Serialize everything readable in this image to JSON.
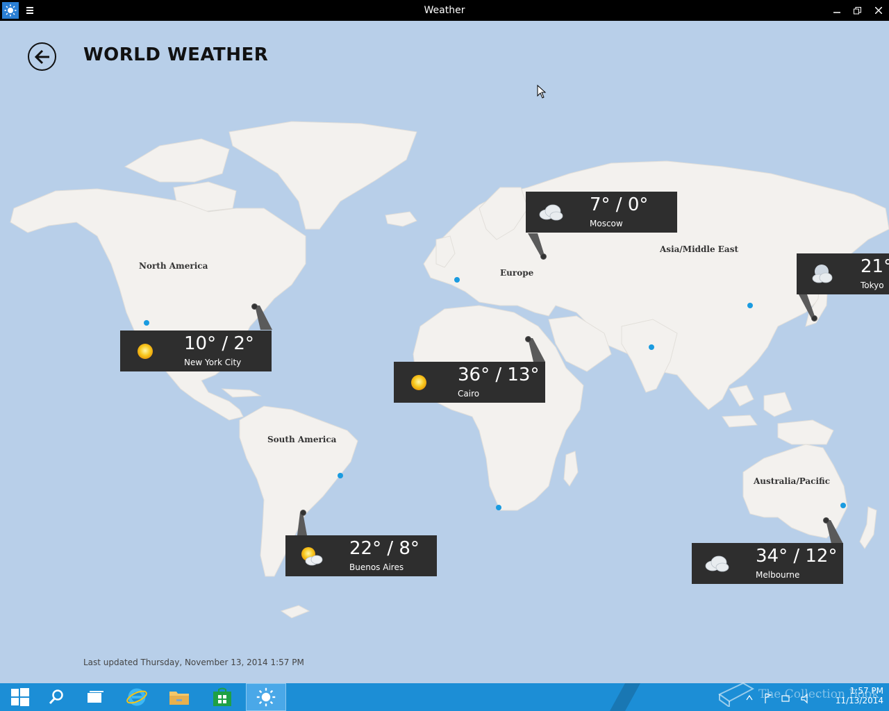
{
  "window": {
    "title": "Weather"
  },
  "header": {
    "title": "WORLD WEATHER"
  },
  "regions": {
    "north_america": "North America",
    "south_america": "South America",
    "europe": "Europe",
    "asia": "Asia/Middle East",
    "australia": "Australia/Pacific"
  },
  "cities": {
    "new_york": {
      "temp": "10° / 2°",
      "name": "New York City",
      "icon": "sunny-icon"
    },
    "cairo": {
      "temp": "36° / 13°",
      "name": "Cairo",
      "icon": "sunny-icon"
    },
    "moscow": {
      "temp": "7° / 0°",
      "name": "Moscow",
      "icon": "cloudy-icon"
    },
    "tokyo": {
      "temp": "21°",
      "name": "Tokyo",
      "icon": "moon-cloudy-icon"
    },
    "buenos_aires": {
      "temp": "22° / 8°",
      "name": "Buenos Aires",
      "icon": "partly-cloudy-icon"
    },
    "melbourne": {
      "temp": "34° / 12°",
      "name": "Melbourne",
      "icon": "cloudy-icon"
    }
  },
  "footer": {
    "updated": "Last updated Thursday, November 13, 2014 1:57 PM"
  },
  "taskbar": {
    "clock_time": "1:57 PM",
    "clock_date": "11/13/2014",
    "watermark": "The Collection Book"
  },
  "colors": {
    "sea": "#b8cfe9",
    "land": "#f3f1ee",
    "card": "#2e2e2e",
    "taskbar": "#1c8ed6",
    "dot": "#1a9be0"
  }
}
